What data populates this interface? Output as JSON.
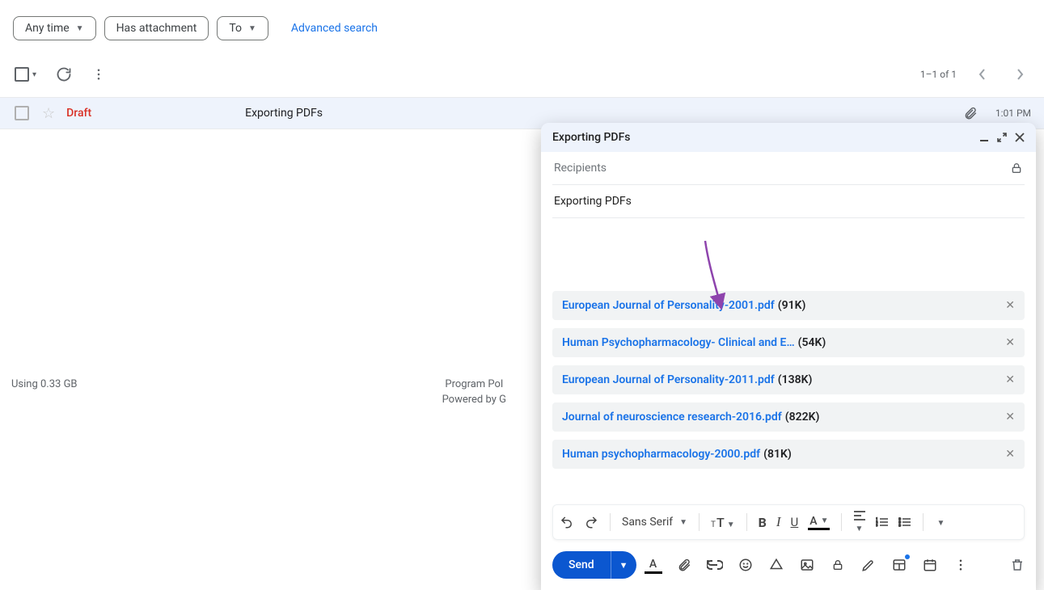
{
  "filters": {
    "any_time": "Any time",
    "has_attachment": "Has attachment",
    "to": "To",
    "advanced": "Advanced search"
  },
  "toolbar": {
    "page_count": "1–1 of 1"
  },
  "mail": {
    "draft_label": "Draft",
    "subject": "Exporting PDFs",
    "time": "1:01 PM"
  },
  "footer": {
    "storage": "Using 0.33 GB",
    "policies": "Program Pol",
    "powered": "Powered by G"
  },
  "compose": {
    "title": "Exporting PDFs",
    "recipients_placeholder": "Recipients",
    "subject_value": "Exporting PDFs",
    "attachments": [
      {
        "name": "European Journal of Personality-2001.pdf",
        "size": "(91K)"
      },
      {
        "name": "Human Psychopharmacology- Clinical and E…",
        "size": "(54K)"
      },
      {
        "name": "European Journal of Personality-2011.pdf",
        "size": "(138K)"
      },
      {
        "name": "Journal of neuroscience research-2016.pdf",
        "size": "(822K)"
      },
      {
        "name": "Human psychopharmacology-2000.pdf",
        "size": "(81K)"
      }
    ],
    "font_family": "Sans Serif",
    "send_label": "Send"
  }
}
